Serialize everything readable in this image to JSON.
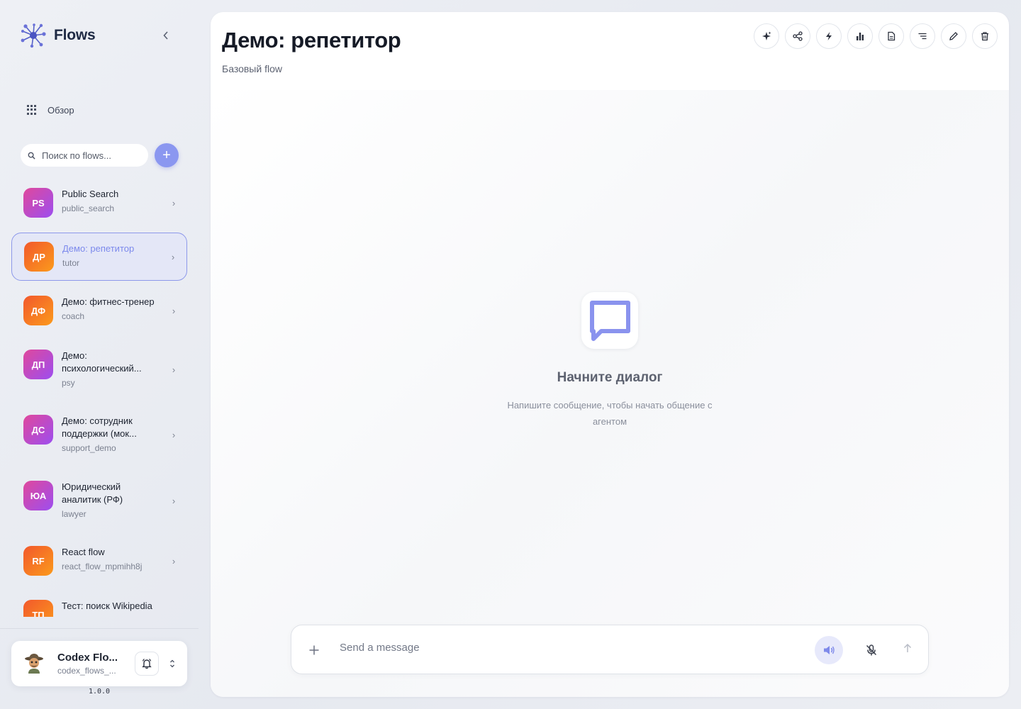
{
  "app": {
    "name": "Flows",
    "logo_icon": "network-nodes-icon",
    "accent": "#8b97f0"
  },
  "sidebar": {
    "overview_label": "Обзор",
    "search": {
      "placeholder": "Поиск по flows..."
    },
    "add_label": "+",
    "flows": [
      {
        "initials": "PS",
        "name": "Public Search",
        "slug": "public_search",
        "color": "purple",
        "active": false
      },
      {
        "initials": "ДР",
        "name": "Демо: репетитор",
        "slug": "tutor",
        "color": "orange",
        "active": true
      },
      {
        "initials": "ДФ",
        "name": "Демо: фитнес-тренер",
        "slug": "coach",
        "color": "orange",
        "active": false
      },
      {
        "initials": "ДП",
        "name": "Демо: психологический...",
        "slug": "psy",
        "color": "purple",
        "active": false
      },
      {
        "initials": "ДС",
        "name": "Демо: сотрудник поддержки (мок...",
        "slug": "support_demo",
        "color": "purple",
        "active": false
      },
      {
        "initials": "ЮА",
        "name": "Юридический аналитик (РФ)",
        "slug": "lawyer",
        "color": "purple",
        "active": false
      },
      {
        "initials": "RF",
        "name": "React flow",
        "slug": "react_flow_mpmihh8j",
        "color": "orange",
        "active": false
      },
      {
        "initials": "ТП",
        "name": "Тест: поиск Wikipedia",
        "slug": "",
        "color": "orange",
        "active": false
      }
    ],
    "user": {
      "name": "Codex Flo...",
      "id": "codex_flows_...",
      "avatar_icon": "explorer-avatar"
    },
    "version": "1.0.0"
  },
  "main": {
    "title": "Демо: репетитор",
    "subtitle": "Базовый flow",
    "toolbar": [
      "sparkle-icon",
      "share-icon",
      "bolt-icon",
      "bar-chart-icon",
      "document-icon",
      "sort-lines-icon",
      "edit-icon",
      "trash-icon"
    ],
    "empty_state": {
      "title": "Начните диалог",
      "description": "Напишите сообщение, чтобы начать общение с агентом"
    },
    "composer": {
      "placeholder": "Send a message"
    }
  }
}
